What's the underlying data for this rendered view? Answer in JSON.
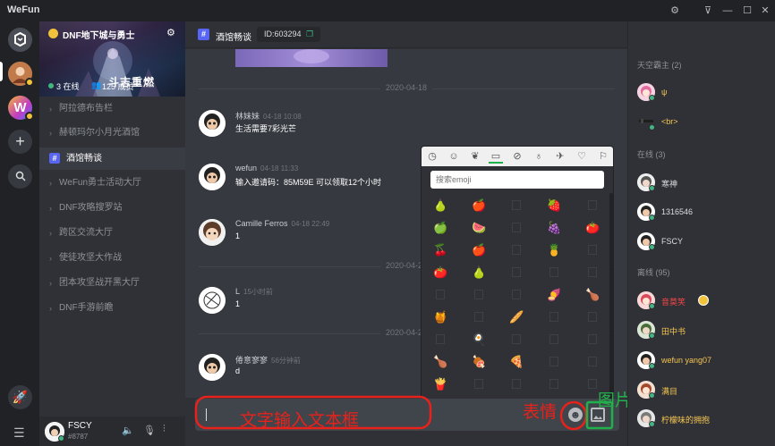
{
  "app": {
    "title": "WeFun"
  },
  "server": {
    "name": "DNF地下城与勇士",
    "online": "3 在线",
    "members": "125 成员",
    "banner_text": "斗志重燃"
  },
  "channels": [
    {
      "label": "阿拉德布告栏"
    },
    {
      "label": "赫顿玛尔小月光酒馆"
    },
    {
      "label": "酒馆畅谈",
      "active": true
    },
    {
      "label": "WeFun勇士活动大厅"
    },
    {
      "label": "DNF攻略搜罗站"
    },
    {
      "label": "跨区交流大厅"
    },
    {
      "label": "使徒攻坚大作战"
    },
    {
      "label": "团本攻坚战开黑大厅"
    },
    {
      "label": "DNF手游前瞻"
    }
  ],
  "header": {
    "hash": "#",
    "channel": "酒馆畅谈",
    "id_label": "ID:603294"
  },
  "messages": [
    {
      "name": "林妹妹",
      "time": "04-18 10:08",
      "text": "生活需要7彩光芒"
    },
    {
      "name": "wefun",
      "time": "04-18 11:33",
      "text": "输入邀请码：85M59E 可以领取12个小时"
    },
    {
      "name": "Camille Ferros",
      "time": "04-18 22:49",
      "text": "1"
    },
    {
      "name": "L",
      "time": "15小时前",
      "text": "1"
    },
    {
      "name": "倦意寥寥",
      "time": "56分钟前",
      "text": "d"
    }
  ],
  "date_separators": [
    "2020-04-18",
    "2020-04-2",
    "2020-04-2"
  ],
  "emoji_picker": {
    "search_placeholder": "搜索emoji",
    "tabs": [
      "clock-icon",
      "smile-icon",
      "leaf-icon",
      "food-icon",
      "ball-icon",
      "bulb-icon",
      "plane-icon",
      "heart-icon",
      "flag-icon"
    ],
    "grid": [
      [
        "🍐",
        "🍎",
        "",
        "🍓",
        "",
        ""
      ],
      [
        "🍏",
        "🍉",
        "",
        "🍇",
        "🍅",
        ""
      ],
      [
        "🍒",
        "🍎",
        "",
        "🍍",
        "",
        ""
      ],
      [
        "🍅",
        "🍐",
        "",
        "",
        "",
        "🌽"
      ],
      [
        "",
        "",
        "",
        "🍠",
        "🍗",
        ""
      ],
      [
        "🍯",
        "",
        "🥖",
        "",
        "",
        ""
      ],
      [
        "",
        "🍳",
        "",
        "",
        "",
        "🌭"
      ],
      [
        "🍗",
        "🍖",
        "🍕",
        "",
        "",
        "🍔"
      ],
      [
        "🍟",
        "",
        "",
        "",
        "",
        ""
      ]
    ]
  },
  "composer": {
    "placeholder": ""
  },
  "user": {
    "name": "FSCY",
    "tag": "#8787"
  },
  "member_list": {
    "groups": [
      {
        "title": "天空霸主 (2)",
        "members": [
          {
            "name": "ψ",
            "color": "yellow"
          },
          {
            "name": "<br>",
            "color": "yellow"
          }
        ]
      },
      {
        "title": "在线 (3)",
        "members": [
          {
            "name": "寒神",
            "color": "white"
          },
          {
            "name": "1316546",
            "color": "white"
          },
          {
            "name": "FSCY",
            "color": "white"
          }
        ]
      },
      {
        "title": "离线 (95)",
        "members": [
          {
            "name": "音莫笑",
            "color": "yellow"
          },
          {
            "name": "田中书",
            "color": "yellow"
          },
          {
            "name": "wefun yang07",
            "color": "yellow"
          },
          {
            "name": "满目",
            "color": "yellow"
          },
          {
            "name": "柠檬味的拥抱",
            "color": "yellow"
          }
        ]
      }
    ]
  },
  "annotations": {
    "input_label": "文字输入文本框",
    "emoji_label": "表情",
    "image_label": "图片"
  },
  "colors": {
    "annotation_red": "#e8221b",
    "annotation_green": "#21b14a",
    "accent": "#5865f2",
    "online": "#43b581"
  }
}
